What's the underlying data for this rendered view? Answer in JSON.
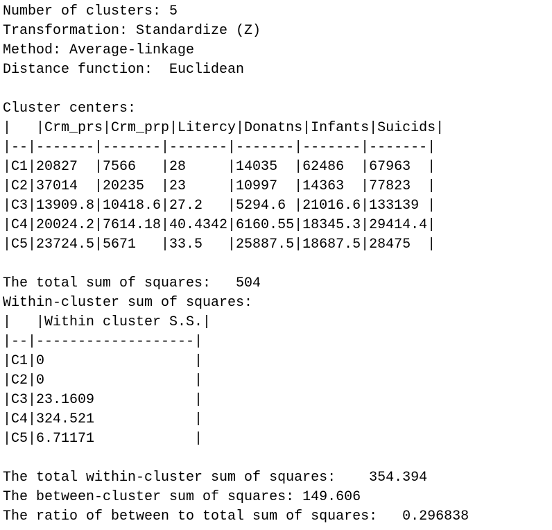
{
  "summary": {
    "clusters_line": "Number of clusters: 5",
    "transformation_line": "Transformation: Standardize (Z)",
    "method_line": "Method: Average-linkage",
    "distance_line": "Distance function:  Euclidean"
  },
  "centers": {
    "heading": "Cluster centers:",
    "header_row": "|   |Crm_prs|Crm_prp|Litercy|Donatns|Infants|Suicids|",
    "separator_row": "|--|-------|-------|-------|-------|-------|-------|",
    "rows": [
      "|C1|20827  |7566   |28     |14035  |62486  |67963  |",
      "|C2|37014  |20235  |23     |10997  |14363  |77823  |",
      "|C3|13909.8|10418.6|27.2   |5294.6 |21016.6|133139 |",
      "|C4|20024.2|7614.18|40.4342|6160.55|18345.3|29414.4|",
      "|C5|23724.5|5671   |33.5   |25887.5|18687.5|28475  |"
    ]
  },
  "total_ss_line": "The total sum of squares:   504",
  "within": {
    "heading": "Within-cluster sum of squares:",
    "header_row": "|   |Within cluster S.S.|",
    "separator_row": "|--|-------------------|",
    "rows": [
      "|C1|0                  |",
      "|C2|0                  |",
      "|C3|23.1609            |",
      "|C4|324.521            |",
      "|C5|6.71171            |"
    ]
  },
  "totals": {
    "total_within_line": "The total within-cluster sum of squares:    354.394",
    "between_line": "The between-cluster sum of squares: 149.606",
    "ratio_line": "The ratio of between to total sum of squares:   0.296838"
  }
}
